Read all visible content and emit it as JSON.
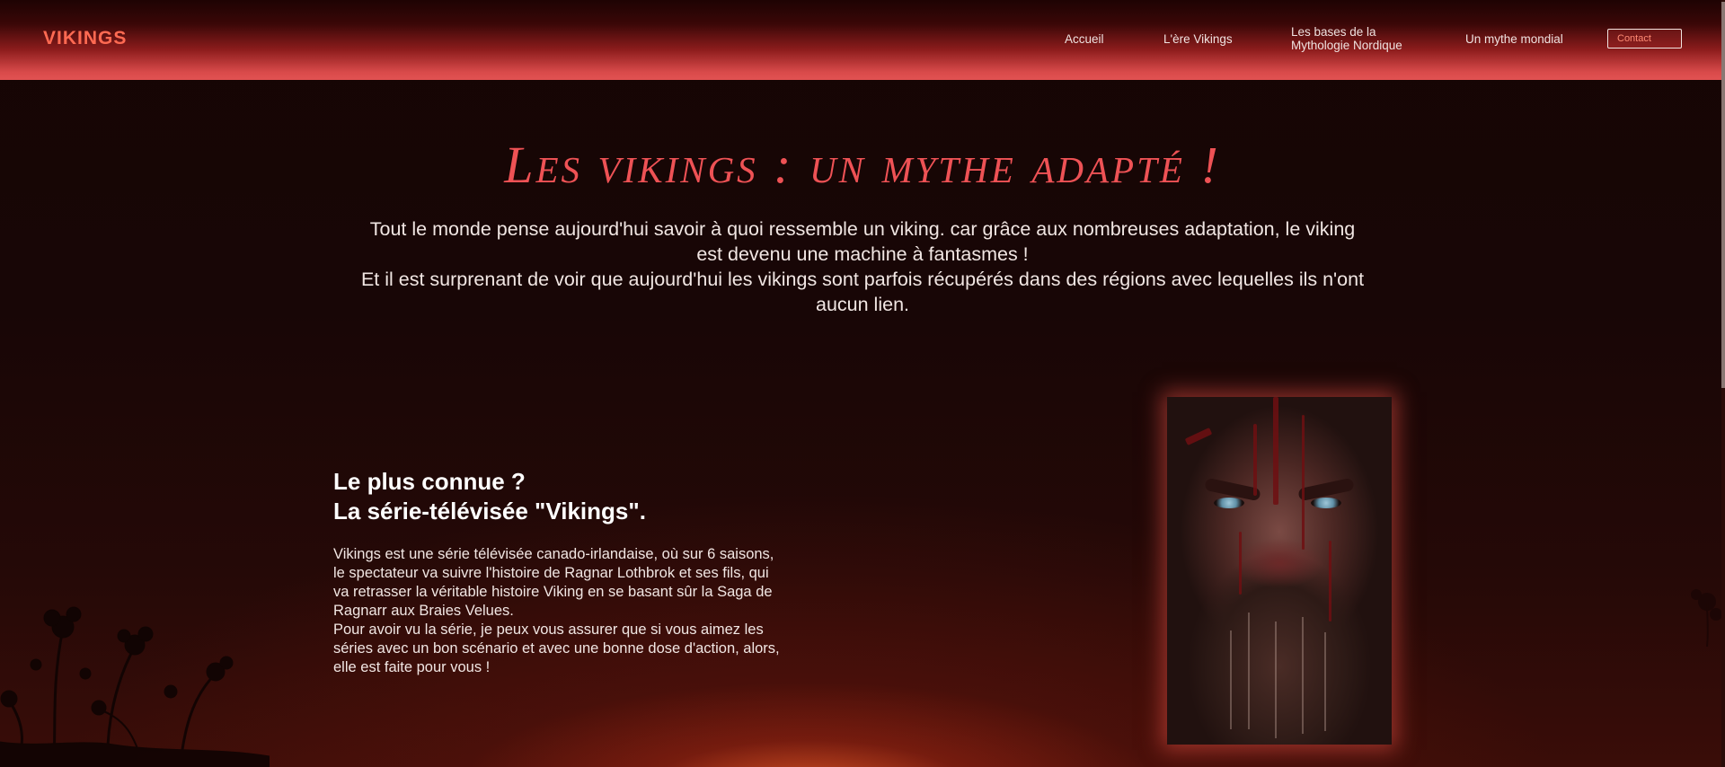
{
  "header": {
    "brand": "VIKINGS",
    "nav": {
      "accueil": "Accueil",
      "ere_vikings": "L'ère Vikings",
      "bases_line1": "Les bases de la",
      "bases_line2": "Mythologie Nordique",
      "mythe_mondial": "Un mythe mondial",
      "contact": "Contact"
    }
  },
  "hero": {
    "title": "Les vikings : un mythe adapté !",
    "line1": "Tout le monde pense aujourd'hui savoir à quoi ressemble un viking. car grâce aux nombreuses adaptation, le viking",
    "line2": "est devenu une machine à fantasmes !",
    "line3": "Et il est surprenant de voir que aujourd'hui les vikings sont parfois récupérés dans des régions avec lequelles ils n'ont",
    "line4": "aucun lien."
  },
  "section": {
    "title_line1": "Le plus connue ?",
    "title_line2": "La série-télévisée \"Vikings\".",
    "body": [
      "Vikings est une série télévisée canado-irlandaise, où sur 6 saisons,",
      "le spectateur va suivre l'histoire de Ragnar Lothbrok et ses fils, qui",
      "va retrasser la véritable histoire Viking en se basant sûr la Saga de",
      "Ragnarr aux Braies Velues.",
      "Pour avoir vu la série, je peux vous assurer que si vous aimez les",
      "séries avec un bon scénario et avec une bonne dose d'action, alors,",
      "elle est faite pour vous !"
    ]
  },
  "colors": {
    "accent": "#ee5255",
    "brand": "#ff6a52",
    "header_bottom": "#e15252",
    "background": "#180606"
  },
  "icons": {
    "photo": "viking-warrior-face-image",
    "silhouette": "wild-plants-silhouette"
  }
}
